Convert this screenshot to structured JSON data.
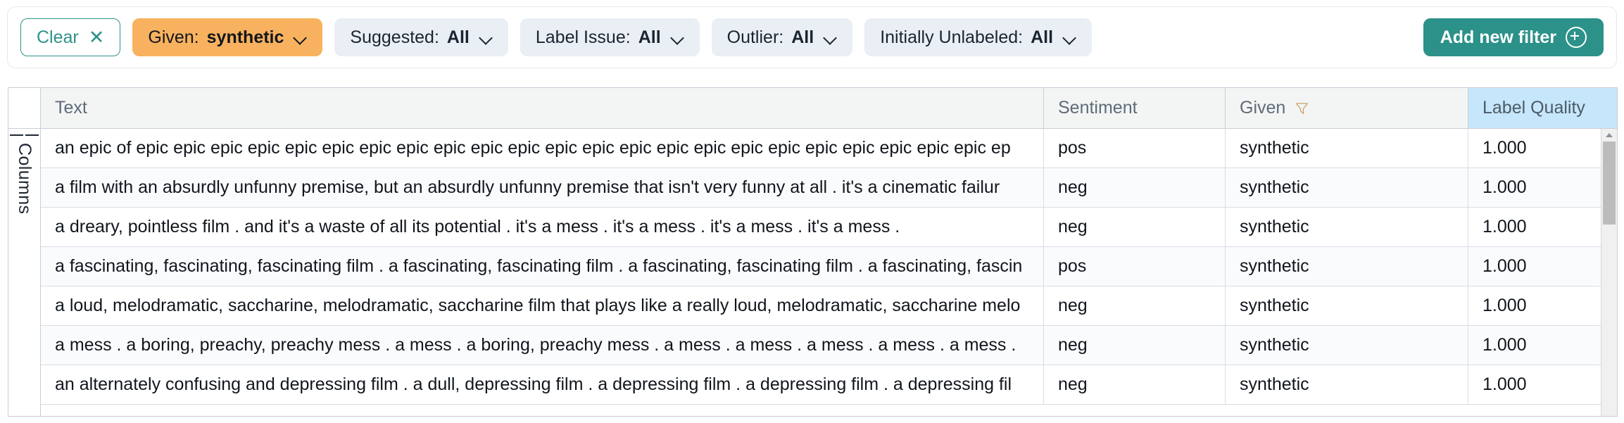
{
  "filter_bar": {
    "clear": {
      "label": "Clear",
      "icon": "close-icon",
      "glyph": "✕"
    },
    "filters": [
      {
        "label": "Given:",
        "value": "synthetic",
        "active": true
      },
      {
        "label": "Suggested:",
        "value": "All",
        "active": false
      },
      {
        "label": "Label Issue:",
        "value": "All",
        "active": false
      },
      {
        "label": "Outlier:",
        "value": "All",
        "active": false
      },
      {
        "label": "Initially Unlabeled:",
        "value": "All",
        "active": false
      }
    ],
    "add_filter": {
      "label": "Add new filter",
      "icon": "plus-circle-icon"
    },
    "colors": {
      "active_chip": "#f8b25f",
      "chip": "#eaeff5",
      "accent": "#2b9189",
      "highlight_header": "#c6e6fb"
    }
  },
  "side_rail": {
    "label": "Columns",
    "icon": "columns-bars-icon"
  },
  "table": {
    "columns": [
      {
        "key": "text",
        "label": "Text",
        "filtered": false,
        "highlight": false
      },
      {
        "key": "sentiment",
        "label": "Sentiment",
        "filtered": false,
        "highlight": false
      },
      {
        "key": "given",
        "label": "Given",
        "filtered": true,
        "highlight": false
      },
      {
        "key": "quality",
        "label": "Label Quality",
        "filtered": false,
        "highlight": true
      }
    ],
    "rows": [
      {
        "text": "an epic of epic epic epic epic epic epic epic epic epic epic epic epic epic epic epic epic epic epic epic epic epic epic epic ep",
        "sentiment": "pos",
        "given": "synthetic",
        "quality": "1.000"
      },
      {
        "text": "a film with an absurdly unfunny premise, but an absurdly unfunny premise that isn't very funny at all . it's a cinematic failur",
        "sentiment": "neg",
        "given": "synthetic",
        "quality": "1.000"
      },
      {
        "text": "a dreary, pointless film . and it's a waste of all its potential . it's a mess . it's a mess . it's a mess . it's a mess .",
        "sentiment": "neg",
        "given": "synthetic",
        "quality": "1.000"
      },
      {
        "text": "a fascinating, fascinating, fascinating film . a fascinating, fascinating film . a fascinating, fascinating film . a fascinating, fascin",
        "sentiment": "pos",
        "given": "synthetic",
        "quality": "1.000"
      },
      {
        "text": "a loud, melodramatic, saccharine, melodramatic, saccharine film that plays like a really loud, melodramatic, saccharine melo",
        "sentiment": "neg",
        "given": "synthetic",
        "quality": "1.000"
      },
      {
        "text": "a mess . a boring, preachy, preachy mess . a mess . a boring, preachy mess . a mess . a mess . a mess . a mess . a mess .",
        "sentiment": "neg",
        "given": "synthetic",
        "quality": "1.000"
      },
      {
        "text": "an alternately confusing and depressing film . a dull, depressing film . a depressing film . a depressing film . a depressing fil",
        "sentiment": "neg",
        "given": "synthetic",
        "quality": "1.000"
      }
    ]
  },
  "scrollbar": {
    "orientation": "vertical",
    "arrow": "caret-up-icon"
  }
}
